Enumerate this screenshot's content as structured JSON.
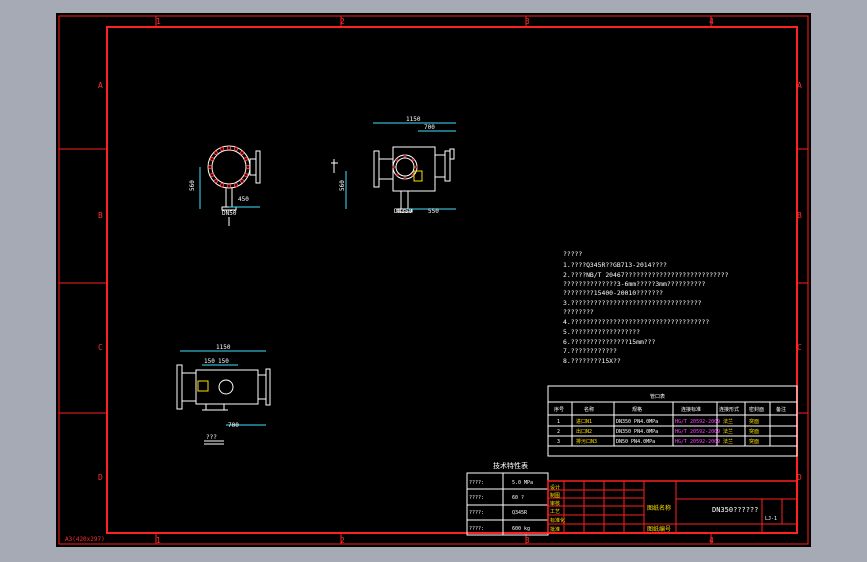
{
  "zones": {
    "top": [
      "1",
      "2",
      "3",
      "4"
    ],
    "side": [
      "A",
      "B",
      "C",
      "D"
    ]
  },
  "sheet_size": "A3(420x297)",
  "views": {
    "view1_dims": {
      "d1": "560",
      "d2": "450",
      "d3": "DN50"
    },
    "view2_dims": {
      "d1": "1150",
      "d2": "700",
      "d3": "560",
      "d4": "DN350",
      "d5": "550"
    },
    "view3_dims": {
      "d1": "1150",
      "d2": "150",
      "d3": "150",
      "d4": "700"
    },
    "view3_label": "???"
  },
  "notes": {
    "title": "?????",
    "lines": [
      "1.????Q345R??GB713-2014????",
      "2.????NB/T 20467???????????????????????????",
      "  ??????????????3-6mm?????3mm??????????",
      "  ????????15400-20010???????",
      "3.??????????????????????????????????",
      "  ????????",
      "4.????????????????????????????????????",
      "5.??????????????????",
      "6.???????????????15mm???",
      "7.????????????",
      "8.????????15X??"
    ]
  },
  "nozzle_table": {
    "title": "管口表",
    "headers": [
      "序号",
      "名称",
      "规格",
      "连接标准",
      "连接形式",
      "密封面",
      "备注"
    ],
    "rows": [
      [
        "1",
        "进口N1",
        "DN350 PN4.0MPa",
        "HG/T 20592-2009",
        "法兰",
        "突面",
        ""
      ],
      [
        "2",
        "出口N2",
        "DN350 PN4.0MPa",
        "HG/T 20592-2009",
        "法兰",
        "突面",
        ""
      ],
      [
        "3",
        "排污口N3",
        "DN50 PN4.0MPa",
        "HG/T 20592-2009",
        "法兰",
        "突面",
        ""
      ]
    ]
  },
  "tech_table": {
    "title": "技术特性表",
    "rows": [
      {
        "label": "????:",
        "value": "5.0 MPa"
      },
      {
        "label": "????:",
        "value": "60 ?"
      },
      {
        "label": "????:",
        "value": "Q345R"
      },
      {
        "label": "????:",
        "value": "600 kg"
      }
    ]
  },
  "title_block": {
    "title": "DN350??????",
    "drawing_no": "LJ-1",
    "row_labels": [
      "设计",
      "制图",
      "审核",
      "工艺",
      "标准化",
      "批准"
    ],
    "mid_label": "图纸名称",
    "bottom_label": "图纸编号"
  }
}
